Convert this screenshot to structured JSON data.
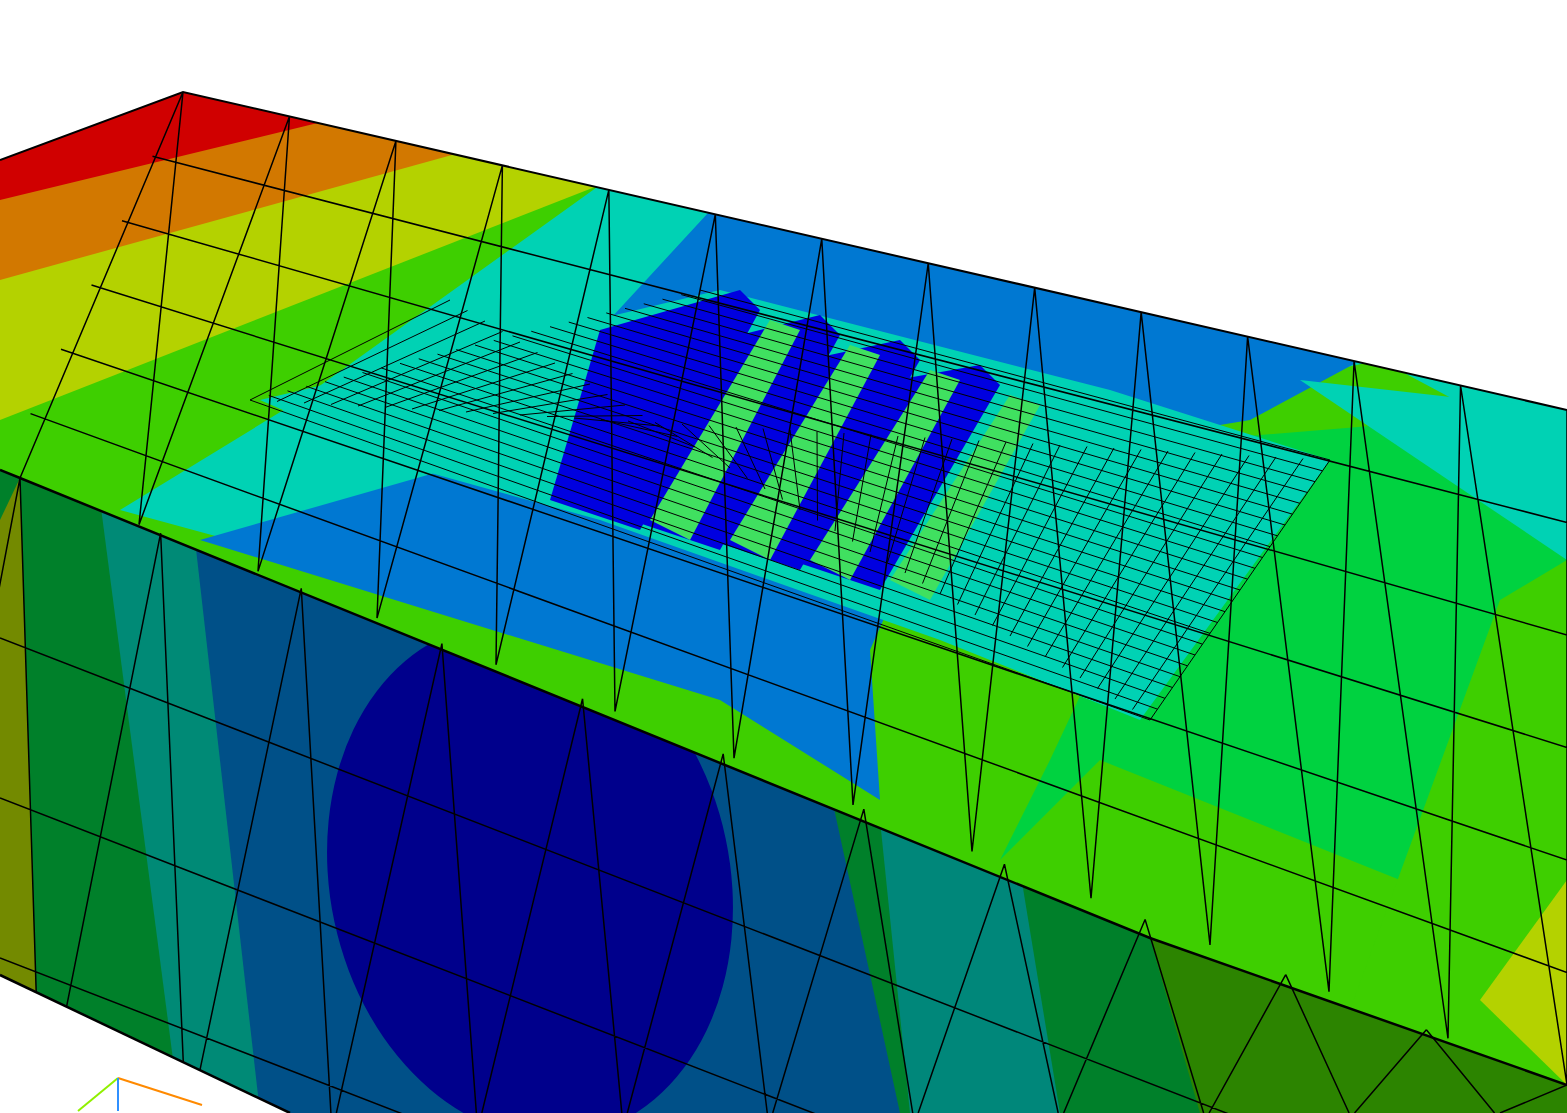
{
  "viewport": {
    "kind": "contour-mesh",
    "axis_triad": true
  }
}
